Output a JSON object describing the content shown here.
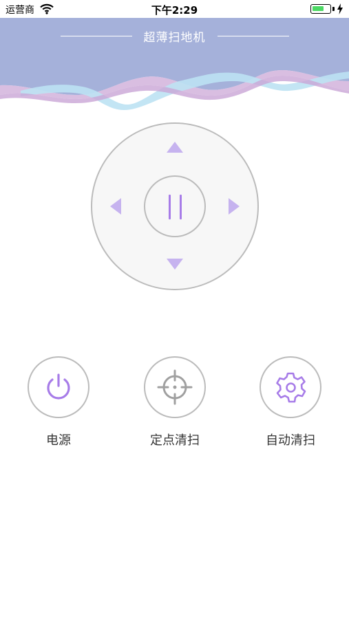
{
  "status_bar": {
    "carrier": "运营商",
    "time": "下午2:29",
    "icons": [
      "wifi-icon",
      "battery-icon",
      "charging-bolt-icon"
    ]
  },
  "header": {
    "title": "超薄扫地机",
    "colors": {
      "background": "#a5b1da",
      "wave_blue": "#bde2f3",
      "wave_purple": "#d5b7de"
    }
  },
  "dpad": {
    "icons": [
      "arrow-up-icon",
      "arrow-down-icon",
      "arrow-left-icon",
      "arrow-right-icon",
      "pause-icon"
    ],
    "accent_color": "#a77ce8",
    "arrow_color": "#c6b3ef"
  },
  "actions": [
    {
      "label": "电源",
      "icon": "power-icon"
    },
    {
      "label": "定点清扫",
      "icon": "crosshair-icon"
    },
    {
      "label": "自动清扫",
      "icon": "gear-icon"
    }
  ]
}
